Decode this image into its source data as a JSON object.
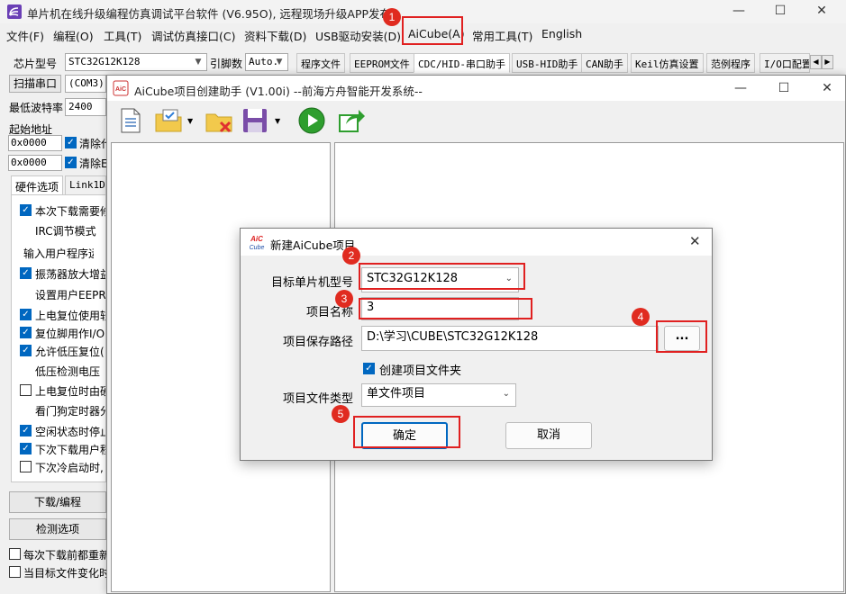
{
  "main_window": {
    "title": "单片机在线升级编程仿真调试平台软件 (V6.95O), 远程现场升级APP发布",
    "menu": [
      "文件(F)",
      "编程(O)",
      "工具(T)",
      "调试仿真接口(C)",
      "资料下载(D)",
      "USB驱动安装(D)",
      "AiCube(A)",
      "常用工具(T)",
      "English"
    ],
    "chip_label": "芯片型号",
    "chip_value": "STC32G12K128",
    "pins_label": "引脚数",
    "pins_value": "Auto.",
    "tabs": [
      "程序文件",
      "EEPROM文件",
      "CDC/HID-串口助手",
      "USB-HID助手",
      "CAN助手",
      "Keil仿真设置",
      "范例程序",
      "I/O口配置"
    ],
    "scan_port": "扫描串口",
    "port_value": "(COM3)",
    "min_baud_label": "最低波特率",
    "min_baud_value": "2400",
    "start_addr_label": "起始地址",
    "addr1": "0x0000",
    "addr2": "0x0000",
    "clear1": "清除代",
    "clear2": "清除E",
    "hw_tabs": [
      "硬件选项",
      "Link1D/"
    ],
    "options": [
      {
        "checked": true,
        "text": "本次下载需要修"
      },
      {
        "checked": null,
        "text": "IRC调节模式"
      },
      {
        "checked": null,
        "text": "输入用户程序运行"
      },
      {
        "checked": true,
        "text": "振荡器放大增益"
      },
      {
        "checked": null,
        "text": "设置用户EEPRO"
      },
      {
        "checked": true,
        "text": "上电复位使用较"
      },
      {
        "checked": true,
        "text": "复位脚用作I/O"
      },
      {
        "checked": true,
        "text": "允许低压复位("
      },
      {
        "checked": null,
        "text": "低压检测电压"
      },
      {
        "checked": false,
        "text": "上电复位时由硬"
      },
      {
        "checked": null,
        "text": "看门狗定时器分"
      },
      {
        "checked": true,
        "text": "空闲状态时停止"
      },
      {
        "checked": true,
        "text": "下次下载用户程"
      },
      {
        "checked": false,
        "text": "下次冷启动时,"
      }
    ],
    "download_btn": "下载/编程",
    "detect_btn": "检测选项",
    "bottom_opts": [
      "每次下载前都重新",
      "当目标文件变化时"
    ]
  },
  "aicube_window": {
    "title": "AiCube项目创建助手 (V1.00i) --前海方舟智能开发系统--",
    "toolbar_icons": [
      "new-document-icon",
      "open-folder-icon",
      "delete-folder-icon",
      "save-icon",
      "run-icon",
      "export-icon"
    ]
  },
  "dialog": {
    "title": "新建AiCube项目",
    "logo_text": "AiC Cube",
    "target_mcu_label": "目标单片机型号",
    "target_mcu_value": "STC32G12K128",
    "project_name_label": "项目名称",
    "project_name_value": "3",
    "save_path_label": "项目保存路径",
    "save_path_value": "D:\\学习\\CUBE\\STC32G12K128",
    "browse_label": "...",
    "create_folder_label": "创建项目文件夹",
    "file_type_label": "项目文件类型",
    "file_type_value": "单文件项目",
    "ok_label": "确定",
    "cancel_label": "取消"
  },
  "annotations": [
    "1",
    "2",
    "3",
    "4",
    "5"
  ],
  "colors": {
    "accent": "#0067c0",
    "annotation_red": "#e02020",
    "run_green": "#2e9e2e"
  }
}
